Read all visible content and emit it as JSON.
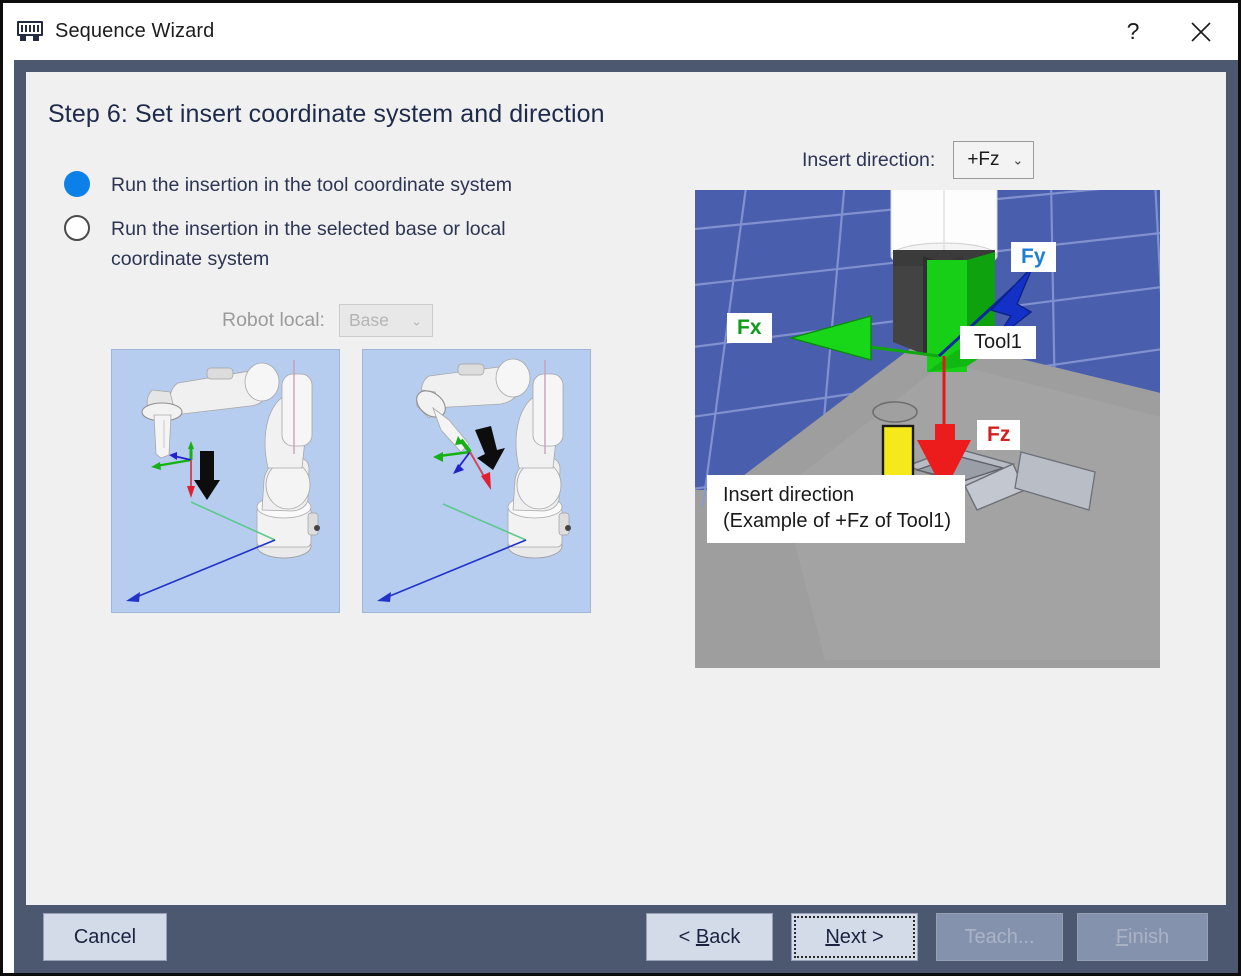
{
  "window": {
    "title": "Sequence Wizard",
    "icon": "chip-icon",
    "help_label": "?",
    "close_label": "✕"
  },
  "dialog": {
    "step_title": "Step 6: Set insert coordinate system and direction",
    "radio_options": [
      {
        "label": "Run the insertion in the tool coordinate system",
        "selected": true
      },
      {
        "label": "Run the insertion in the selected base or local coordinate system",
        "selected": false
      }
    ],
    "robot_local": {
      "label": "Robot local:",
      "value": "Base",
      "caret": "⌄",
      "disabled": true
    },
    "insert_direction": {
      "label": "Insert direction:",
      "value": "+Fz",
      "caret": "⌄",
      "disabled": false
    },
    "thumbnails": [
      {
        "name": "tool-coordinate-preview",
        "alt": "Robot arm with tool coordinate axes and downward insert arrow"
      },
      {
        "name": "base-coordinate-preview",
        "alt": "Robot arm with base coordinate axes and angled insert arrow"
      }
    ],
    "viewport": {
      "labels": [
        {
          "text": "Fy",
          "color": "#1e7fd6"
        },
        {
          "text": "Fx",
          "color": "#0f9c18"
        },
        {
          "text": "Tool1",
          "color": "#1a1a1a"
        },
        {
          "text": "Fz",
          "color": "#d32020"
        }
      ],
      "caption": "Insert direction\n(Example of +Fz of Tool1)"
    }
  },
  "footer": {
    "cancel": "Cancel",
    "back_prefix": "< ",
    "back_accel": "B",
    "back_rest": "ack",
    "next_accel": "N",
    "next_rest": "ext >",
    "teach": "Teach...",
    "finish_accel": "F",
    "finish_rest": "inish"
  },
  "colors": {
    "frame": "#4c5870",
    "panel": "#f0f0f0",
    "accent": "#0b80e8",
    "heading": "#1d2a4a",
    "button_face": "#d3dae8",
    "button_disabled": "#8592ad"
  }
}
